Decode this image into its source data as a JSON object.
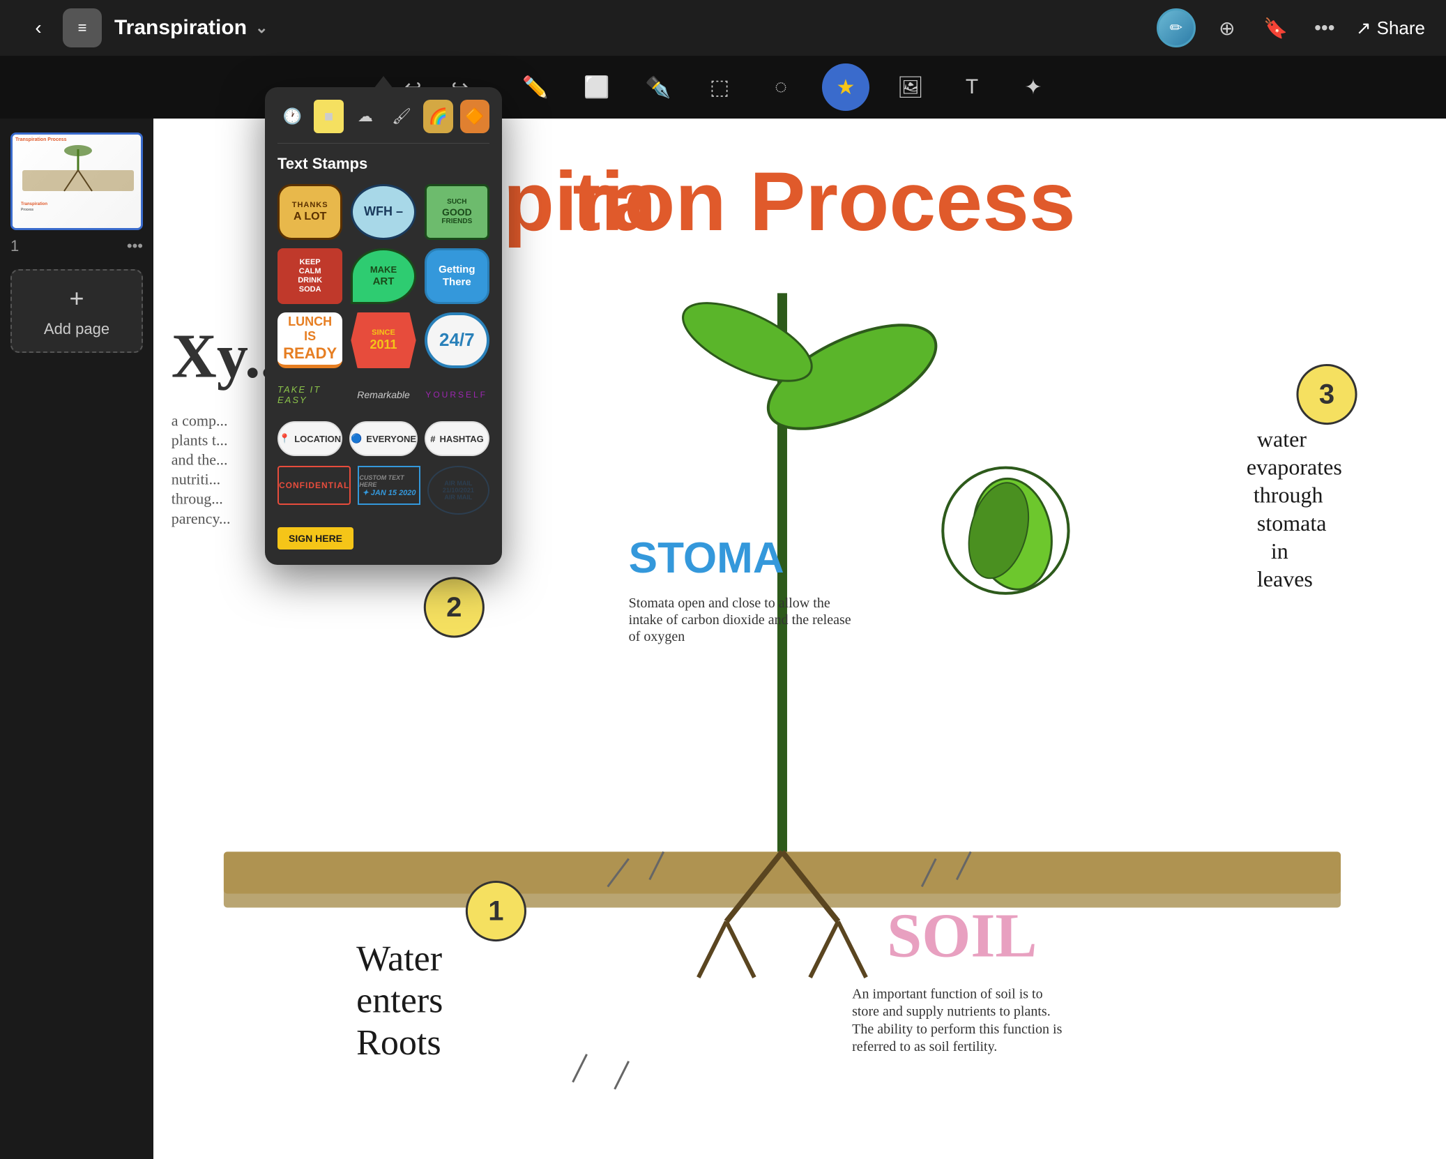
{
  "app": {
    "title": "Transpiration",
    "back_label": "‹",
    "chevron": "⌄",
    "doc_icon": "≡",
    "more_label": "•••",
    "share_label": "Share",
    "add_page_icon": "+",
    "add_page_label": "Add page"
  },
  "toolbar": {
    "undo": "↩",
    "redo": "↪",
    "pencil_icon": "✏",
    "eraser_icon": "⬜",
    "pen_icon": "✒",
    "selection_icon": "⬚",
    "lasso_icon": "◌",
    "sticker_icon": "★",
    "image_icon": "⬙",
    "text_icon": "T",
    "magic_icon": "✦"
  },
  "sticker_panel": {
    "title": "Text Stamps",
    "tabs": [
      {
        "id": "recent",
        "icon": "🕐"
      },
      {
        "id": "square",
        "icon": "■",
        "color": "#f5e060"
      },
      {
        "id": "cloud",
        "icon": "☁"
      },
      {
        "id": "sticker1",
        "icon": "🖌"
      },
      {
        "id": "sticker2",
        "icon": "🌈"
      },
      {
        "id": "sticker3",
        "icon": "🔶"
      }
    ],
    "stamps": [
      {
        "id": "thanks",
        "line1": "THANKS",
        "line2": "A LOT",
        "style": "thanks"
      },
      {
        "id": "wfh",
        "text": "WFH –",
        "style": "wfh"
      },
      {
        "id": "good",
        "line1": "SUCH",
        "line2": "GOOD",
        "line3": "FRIENDS",
        "style": "good"
      },
      {
        "id": "keepcalm",
        "line1": "KEEP",
        "line2": "CALM",
        "line3": "DRINK",
        "line4": "SODA",
        "style": "keepcalm"
      },
      {
        "id": "makeart",
        "line1": "MAKE",
        "line2": "ART",
        "style": "makeart"
      },
      {
        "id": "getting",
        "line1": "Getting",
        "line2": "There",
        "style": "getting"
      },
      {
        "id": "lunch",
        "line1": "LUNCH IS",
        "line2": "READY",
        "style": "lunch"
      },
      {
        "id": "since",
        "line1": "SINCE",
        "line2": "2011",
        "style": "since"
      },
      {
        "id": "247",
        "text": "24/7",
        "style": "247"
      }
    ],
    "text_styles": [
      {
        "id": "takeeasy",
        "text": "TAKE IT EASY",
        "style": "takeeasy"
      },
      {
        "id": "remarkable",
        "text": "Remarkable",
        "style": "remarkable"
      },
      {
        "id": "yourself",
        "text": "YOURSELF",
        "style": "yourself"
      }
    ],
    "badges": [
      {
        "id": "location",
        "icon": "📍",
        "text": "LOCATION"
      },
      {
        "id": "everyone",
        "icon": "🔵",
        "text": "EVERYONE"
      },
      {
        "id": "hashtag",
        "icon": "#",
        "text": "HASHTAG"
      }
    ],
    "stamps_row": [
      {
        "id": "confidential",
        "text": "CONFIDENTIAL",
        "style": "confidential"
      },
      {
        "id": "custom",
        "text": "CUSTOM TEXT HERE  JAN 15 2020",
        "style": "custom"
      },
      {
        "id": "airmail",
        "text": "AIR MAIL 21/10/2021",
        "style": "airmail"
      }
    ],
    "sign_here": "SIGN HERE"
  },
  "canvas": {
    "title": "ion Process",
    "partial_title": "Transpirat",
    "number3_label": "3",
    "water_evap": "water\nevaporates\nthrough\nstomata\nin leaves",
    "stoma_label": "STOMA",
    "stoma_desc": "Stomata open and close to allow the intake of carbon dioxide and the release of oxygen",
    "water_enters_num": "1",
    "water_enters": "Water\nenters\nRoots",
    "soil_label": "SOIL",
    "soil_desc": "An important function of soil is to store and supply nutrients to plants. The ability to perform this function is referred to as soil fertility.",
    "num2_label": "2",
    "xy_label": "Xy..."
  },
  "page": {
    "number": "1",
    "thumb_title": "Transpiration Process"
  }
}
